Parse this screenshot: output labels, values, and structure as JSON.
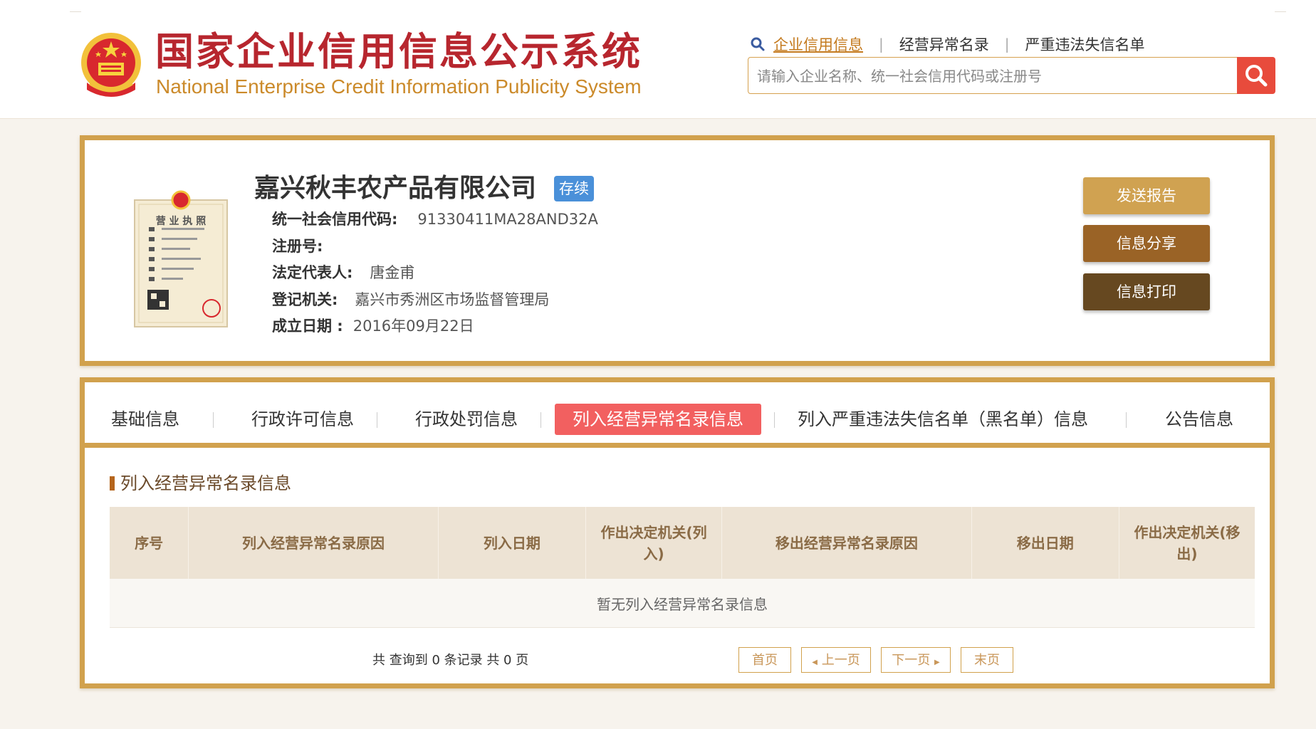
{
  "header": {
    "title_cn": "国家企业信用信息公示系统",
    "title_en": "National Enterprise Credit Information Publicity System",
    "nav": [
      {
        "label": "企业信用信息",
        "active": true
      },
      {
        "label": "经营异常名录",
        "active": false
      },
      {
        "label": "严重违法失信名单",
        "active": false
      }
    ],
    "nav_sep": "|",
    "search": {
      "placeholder": "请输入企业名称、统一社会信用代码或注册号",
      "value": ""
    }
  },
  "company": {
    "name": "嘉兴秋丰农产品有限公司",
    "status": "存续",
    "license_title": "营 业 执 照",
    "fields": [
      {
        "label": "统一社会信用代码:",
        "value": "91330411MA28AND32A"
      },
      {
        "label": "注册号:",
        "value": ""
      },
      {
        "label": "法定代表人:",
        "value": "唐金甫"
      },
      {
        "label": "登记机关:",
        "value": "嘉兴市秀洲区市场监督管理局"
      },
      {
        "label": "成立日期 :",
        "value": "2016年09月22日"
      }
    ],
    "actions": [
      {
        "label": "发送报告",
        "color": "#d0a251"
      },
      {
        "label": "信息分享",
        "color": "#9a6326"
      },
      {
        "label": "信息打印",
        "color": "#664820"
      }
    ]
  },
  "tabs": [
    {
      "label": "基础信息",
      "active": false
    },
    {
      "label": "行政许可信息",
      "active": false
    },
    {
      "label": "行政处罚信息",
      "active": false
    },
    {
      "label": "列入经营异常名录信息",
      "active": true
    },
    {
      "label": "列入严重违法失信名单（黑名单）信息",
      "active": false
    },
    {
      "label": "公告信息",
      "active": false
    }
  ],
  "section": {
    "title": "列入经营异常名录信息",
    "columns": [
      "序号",
      "列入经营异常名录原因",
      "列入日期",
      "作出决定机关(列入)",
      "移出经营异常名录原因",
      "移出日期",
      "作出决定机关(移出)"
    ],
    "empty_text": "暂无列入经营异常名录信息"
  },
  "pager": {
    "summary": "共 查询到 0 条记录 共 0 页",
    "first": "首页",
    "prev": "上一页",
    "next": "下一页",
    "last": "末页"
  },
  "colors": {
    "brand_red": "#b7262e",
    "brand_gold": "#d1a14d",
    "tab_active": "#f26060",
    "badge_blue": "#4a90d9",
    "search_btn": "#e84b3c"
  }
}
